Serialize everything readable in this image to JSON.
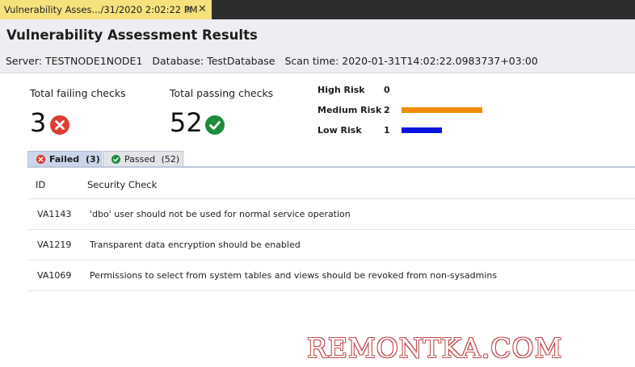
{
  "document_tab": {
    "title": "Vulnerability Asses.../31/2020 2:02:22 PM",
    "pin_glyph": "⊕",
    "close_glyph": "✕"
  },
  "header": {
    "title": "Vulnerability Assessment Results",
    "server": "Server: TESTNODE1NODE1",
    "database": "Database: TestDatabase",
    "scan_time": "Scan time: 2020-01-31T14:02:22.0983737+03:00"
  },
  "summary": {
    "failing_label": "Total failing checks",
    "failing_value": "3",
    "passing_label": "Total passing checks",
    "passing_value": "52"
  },
  "risk": [
    {
      "label": "High Risk",
      "count": "0",
      "value": 0,
      "color": "#e28a00"
    },
    {
      "label": "Medium Risk",
      "count": "2",
      "value": 2,
      "color": "#f08c00"
    },
    {
      "label": "Low Risk",
      "count": "1",
      "value": 1,
      "color": "#0a14e0"
    }
  ],
  "tabs": {
    "failed": "Failed",
    "failed_count": "(3)",
    "passed": "Passed",
    "passed_count": "(52)"
  },
  "table": {
    "columns": [
      "ID",
      "Security Check"
    ],
    "rows": [
      {
        "id": "VA1143",
        "check": "'dbo' user should not be used for normal service operation"
      },
      {
        "id": "VA1219",
        "check": "Transparent data encryption should be enabled"
      },
      {
        "id": "VA1069",
        "check": "Permissions to select from system tables and views should be revoked from non-sysadmins"
      }
    ]
  },
  "colors": {
    "fail": "#e03c31",
    "pass": "#1e8c3c",
    "tab_strip": "#2d2d30",
    "active_doc_tab": "#f5e27d"
  },
  "watermark": "REMONTKA.COM"
}
